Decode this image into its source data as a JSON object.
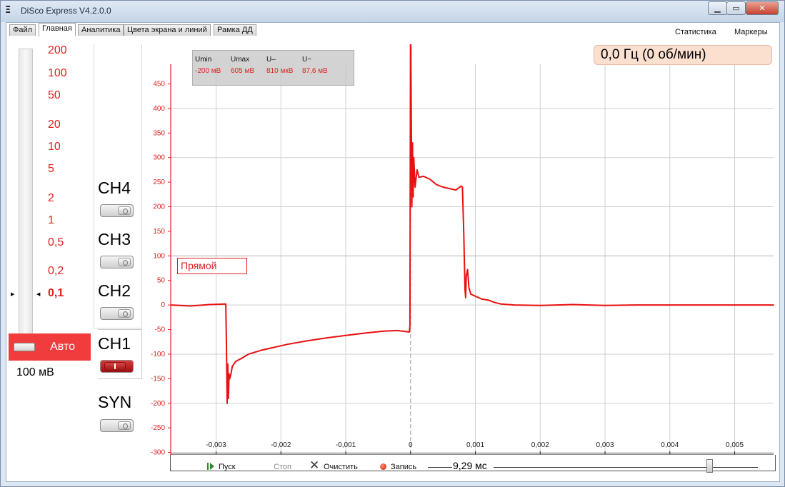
{
  "window": {
    "title": "DiSco Express V4.2.0.0",
    "app_icon": "Ξ"
  },
  "window_buttons": {
    "minimize": "▁",
    "maximize": "▭",
    "close": "✕"
  },
  "tabs": [
    "Файл",
    "Главная",
    "Аналитика",
    "Цвета экрана и линий",
    "Рамка ДД"
  ],
  "active_tab": "Главная",
  "right_menu": {
    "statistics": "Статистика",
    "markers": "Маркеры"
  },
  "scale": {
    "labels": [
      "200",
      "100",
      "50",
      "20",
      "10",
      "5",
      "2",
      "1",
      "0,5",
      "0,2",
      "0,1"
    ],
    "selected": "0,1",
    "auto_label": "Авто",
    "value": "100 мВ"
  },
  "channels": [
    {
      "label": "CH4",
      "state": "off"
    },
    {
      "label": "CH3",
      "state": "off"
    },
    {
      "label": "CH2",
      "state": "off"
    },
    {
      "label": "CH1",
      "state": "on"
    },
    {
      "label": "SYN",
      "state": "off"
    }
  ],
  "stats": {
    "umin": {
      "label": "Umin",
      "value": "-200 мВ"
    },
    "umax": {
      "label": "Umax",
      "value": "605 мВ"
    },
    "udc": {
      "label": "U–",
      "value": "810 мкВ"
    },
    "uac": {
      "label": "U~",
      "value": "87,6 мВ"
    }
  },
  "frequency": "0,0 Гц (0 об/мин)",
  "mode": "Прямой",
  "colors": {
    "trace": "#e81010",
    "axis_labels": "#e02020",
    "grid": "#cfcfcf",
    "auto_button": "#f03c3c"
  },
  "chart_data": {
    "type": "line",
    "xlim": [
      -0.0037,
      0.0056
    ],
    "ylim": [
      -305,
      490
    ],
    "x_ticks": [
      -0.003,
      -0.002,
      -0.001,
      0,
      0.001,
      0.002,
      0.003,
      0.004,
      0.005
    ],
    "x_tick_labels": [
      "-0,003",
      "-0,002",
      "-0,001",
      "0",
      "0,001",
      "0,002",
      "0,003",
      "0,004",
      "0,005"
    ],
    "y_ticks": [
      450,
      400,
      350,
      300,
      250,
      200,
      150,
      100,
      50,
      0,
      -50,
      -100,
      -150,
      -200,
      -250,
      -300
    ],
    "grid": true,
    "series": [
      {
        "x": [
          -0.0037,
          -0.0034,
          -0.0031,
          -0.00285,
          -0.00284,
          -0.00283,
          -0.00282,
          -0.00281,
          -0.0028,
          -0.00279,
          -0.00277,
          -0.00275,
          -0.0027,
          -0.0026,
          -0.0025,
          -0.0023,
          -0.0021,
          -0.0019,
          -0.0016,
          -0.0013,
          -0.001,
          -0.0007,
          -0.0004,
          -0.0002,
          -2e-05,
          -1e-05,
          0,
          2e-05,
          3e-05,
          4e-05,
          5e-05,
          7e-05,
          0.0001,
          0.00013,
          0.0002,
          0.0003,
          0.0004,
          0.0005,
          0.0006,
          0.0007,
          0.00078,
          0.0008,
          0.00082,
          0.00084,
          0.00085,
          0.00086,
          0.00088,
          0.0009,
          0.00093,
          0.001,
          0.0011,
          0.0012,
          0.0013,
          0.0014,
          0.0016,
          0.002,
          0.0025,
          0.003,
          0.0035,
          0.004,
          0.0045,
          0.005,
          0.0056
        ],
        "y": [
          0,
          -2,
          1,
          2,
          -80,
          -200,
          -120,
          -190,
          -140,
          -150,
          -140,
          -125,
          -115,
          -108,
          -100,
          -92,
          -86,
          -80,
          -73,
          -67,
          -62,
          -57,
          -53,
          -52,
          -55,
          -43,
          605,
          200,
          330,
          220,
          300,
          240,
          275,
          260,
          262,
          256,
          245,
          240,
          237,
          234,
          242,
          240,
          150,
          32,
          15,
          60,
          72,
          35,
          22,
          18,
          12,
          10,
          5,
          2,
          0,
          -1,
          1,
          -1,
          0,
          0,
          0,
          0,
          0
        ]
      }
    ]
  },
  "toolbar": {
    "start": "Пуск",
    "stop": "Стоп",
    "clear": "Очистить",
    "record": "Запись",
    "timebase": "9,29 мс"
  },
  "icons": {
    "play": "play-icon",
    "clear": "x-icon",
    "record": "record-dot-icon"
  }
}
